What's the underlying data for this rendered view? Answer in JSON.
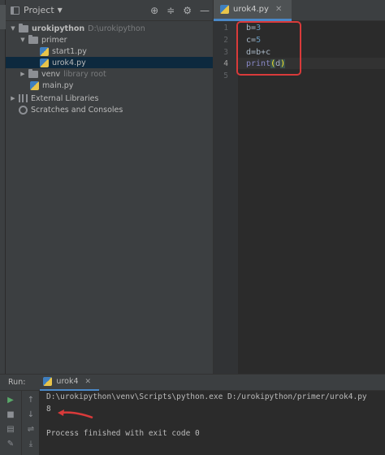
{
  "colors": {
    "accent": "#4a88c7",
    "annotation": "#d93a3a",
    "selected_row": "#0d293e"
  },
  "project_panel": {
    "title": "Project",
    "toolbar_icons": [
      "crosshair-icon",
      "collapse-icon",
      "gear-icon",
      "minimize-icon"
    ],
    "tree": [
      {
        "label": "urokipython",
        "hint": "D:\\urokipython",
        "indent": 0,
        "expanded": true,
        "icon": "folder-icon"
      },
      {
        "label": "primer",
        "hint": "",
        "indent": 1,
        "expanded": true,
        "icon": "folder-icon"
      },
      {
        "label": "start1.py",
        "hint": "",
        "indent": 2,
        "icon": "python-file-icon"
      },
      {
        "label": "urok4.py",
        "hint": "",
        "indent": 2,
        "icon": "python-file-icon",
        "selected": true
      },
      {
        "label": "venv",
        "hint": "library root",
        "indent": 1,
        "expanded": false,
        "icon": "folder-icon"
      },
      {
        "label": "main.py",
        "hint": "",
        "indent": 1,
        "icon": "python-file-icon"
      },
      {
        "label": "External Libraries",
        "hint": "",
        "indent": 0,
        "expanded": false,
        "icon": "library-icon"
      },
      {
        "label": "Scratches and Consoles",
        "hint": "",
        "indent": 0,
        "icon": "scratches-icon"
      }
    ]
  },
  "editor": {
    "tab_label": "urok4.py",
    "current_line": 4,
    "lines": [
      {
        "no": "1",
        "text": "b=3"
      },
      {
        "no": "2",
        "text": "c=5"
      },
      {
        "no": "3",
        "text": "d=b+c"
      },
      {
        "no": "4",
        "text": "print(d)"
      },
      {
        "no": "5",
        "text": ""
      }
    ],
    "code_tokens": {
      "l1": {
        "var": "b",
        "op": "=",
        "num": "3"
      },
      "l2": {
        "var": "c",
        "op": "=",
        "num": "5"
      },
      "l3": {
        "var": "d",
        "op": "=",
        "expr": "b+c"
      },
      "l4": {
        "fn": "print",
        "open": "(",
        "arg": "d",
        "close": ")"
      }
    }
  },
  "run_panel": {
    "title": "Run:",
    "tab_label": "urok4",
    "console": [
      "D:\\urokipython\\venv\\Scripts\\python.exe D:/urokipython/primer/urok4.py",
      "8",
      "",
      "Process finished with exit code 0"
    ]
  }
}
